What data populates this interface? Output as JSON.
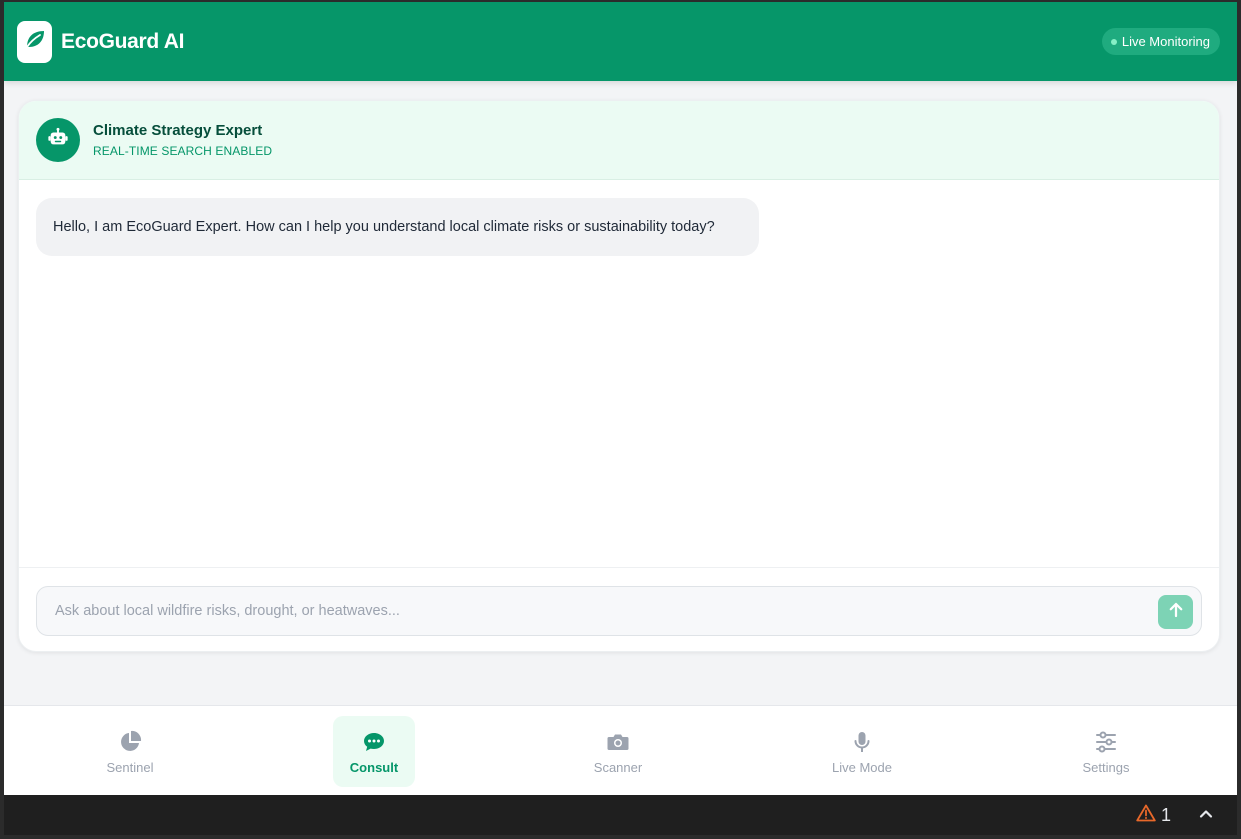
{
  "app": {
    "title": "EcoGuard AI",
    "status_label": "Live Monitoring",
    "brand_color": "#069669",
    "logo_icon": "leaf-icon"
  },
  "chat": {
    "expert_name": "Climate Strategy Expert",
    "expert_subtitle": "REAL-TIME SEARCH ENABLED",
    "avatar_icon": "robot-icon",
    "messages": [
      {
        "role": "assistant",
        "text": "Hello, I am EcoGuard Expert. How can I help you understand local climate risks or sustainability today?"
      }
    ],
    "input_placeholder": "Ask about local wildfire risks, drought, or heatwaves...",
    "input_value": "",
    "send_icon": "arrow-up-icon"
  },
  "nav": {
    "items": [
      {
        "label": "Sentinel",
        "icon": "pie-chart-icon",
        "active": false
      },
      {
        "label": "Consult",
        "icon": "chat-bubble-icon",
        "active": true
      },
      {
        "label": "Scanner",
        "icon": "camera-icon",
        "active": false
      },
      {
        "label": "Live Mode",
        "icon": "microphone-icon",
        "active": false
      },
      {
        "label": "Settings",
        "icon": "sliders-icon",
        "active": false
      }
    ]
  },
  "taskbar": {
    "warning_count": "1",
    "warning_icon": "warning-triangle-icon",
    "expand_icon": "chevron-up-icon"
  }
}
